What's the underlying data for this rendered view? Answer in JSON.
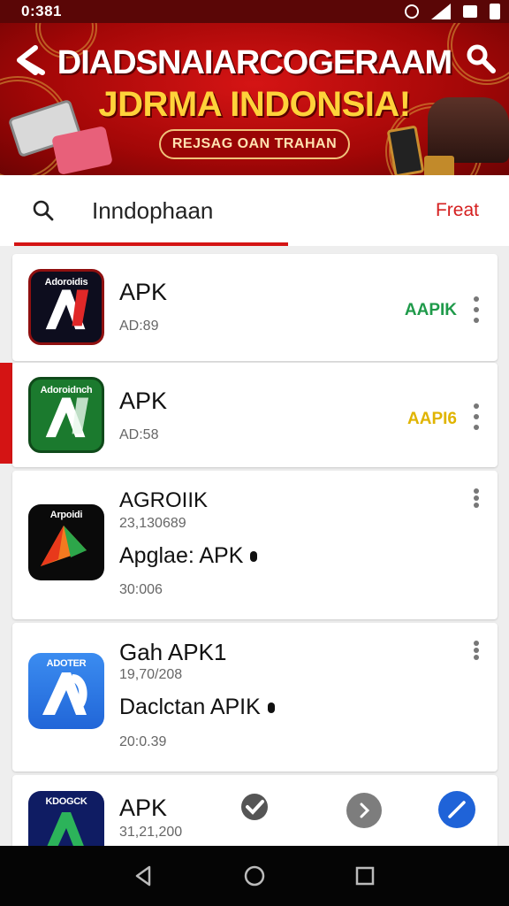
{
  "status": {
    "time": "0:381"
  },
  "banner": {
    "title": "DIADSNAIARCOGERAAM",
    "subtitle": "JDRMA INDONSIA!",
    "button_label": "REJSAG OAN TRAHAN",
    "brand_color": "#c00d0d"
  },
  "search": {
    "query": "Inndophaan",
    "action_label": "Freat"
  },
  "apps": [
    {
      "icon_label": "Adoroidis",
      "name": "APK",
      "meta": "AD:89",
      "tag": "AAPIK",
      "tag_color": "#1f9a4a",
      "icon_bg": "#7a0d0d"
    },
    {
      "icon_label": "Adoroidnch",
      "name": "APK",
      "meta": "AD:58",
      "tag": "AAPI6",
      "tag_color": "#e0b400",
      "icon_bg": "#1b7a2e"
    },
    {
      "icon_label": "Arpoidi",
      "name": "AGROIIK",
      "meta": "23,130689",
      "subtitle": "Apglae: APK",
      "meta2": "30:006",
      "icon_bg": "#0a0a0a"
    },
    {
      "icon_label": "ADOTER",
      "name": "Gah APK1",
      "meta": "19,70/208",
      "subtitle": "Daclctan APIK",
      "meta2": "20:0.39",
      "icon_bg": "#2f7be6"
    },
    {
      "icon_label": "KDOGCK",
      "name": "APK",
      "meta": "31,21,200",
      "icon_bg": "#0f1c63"
    }
  ]
}
